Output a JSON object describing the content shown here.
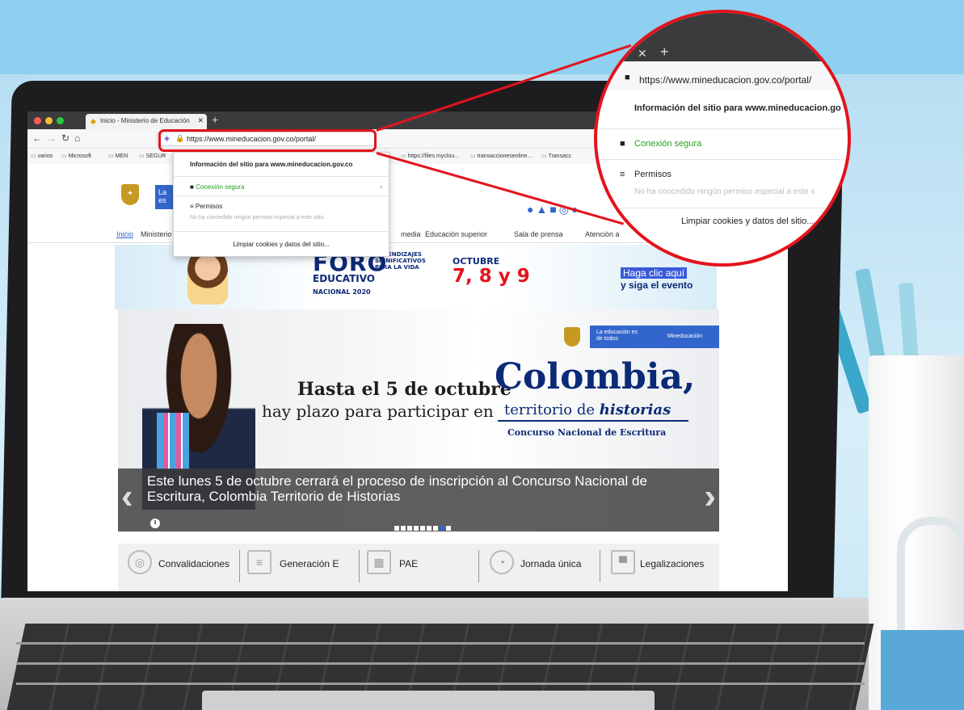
{
  "browser": {
    "tab_title": "Inicio - Ministerio de Educación",
    "tab_close": "✕",
    "new_tab": "+",
    "url": "https://www.mineducacion.gov.co/portal/",
    "bookmarks": [
      "varios",
      "Microsoft",
      "MEN",
      "SEGUR",
      "https://files.myclou...",
      "transaccionesenline...",
      "Transacc"
    ]
  },
  "site_info_popup": {
    "title": "Información del sitio para www.mineducacion.gov.co",
    "secure": "Conexión segura",
    "permissions": "Permisos",
    "permissions_detail": "No ha concedido ningún permiso especial a este sitio.",
    "clear": "Limpiar cookies y datos del sitio..."
  },
  "zoom": {
    "url": "https://www.mineducacion.gov.co/portal/",
    "title": "Información del sitio para www.mineducacion.go",
    "secure": "Conexión segura",
    "permissions": "Permisos",
    "permissions_detail": "No ha concedido ningún permiso especial a este s",
    "clear": "Limpiar cookies y datos del sitio..."
  },
  "site": {
    "logo_text": "La es",
    "menu": [
      "Inicio",
      "Ministerio",
      "media",
      "Educación superior",
      "Sala de prensa",
      "Atención a"
    ],
    "banner": {
      "foro": "FORO",
      "educativo": "EDUCATIVO",
      "nacional": "NACIONAL 2020",
      "small": "APRENDIZAJES SIGNIFICATIVOS PARA LA VIDA",
      "octubre": "OCTUBRE",
      "dates": "7, 8 y 9",
      "cta1": "Haga clic aquí",
      "cta2": "y siga el evento"
    },
    "hero": {
      "badge_text": "La educación es de todos",
      "badge_brand": "Mineducación",
      "line1": "Hasta el 5 de octubre",
      "line2": "hay plazo para participar en",
      "colombia": "Colombia,",
      "territorio": "territorio de",
      "historias": "historias",
      "concurso": "Concurso Nacional de Escritura",
      "caption": "Este lunes 5 de octubre cerrará el proceso de inscripción al Concurso Nacional de Escritura, Colombia Territorio de Historias",
      "slides": 9,
      "active_slide": 8
    },
    "quick_links": [
      "Convalidaciones",
      "Generación E",
      "PAE",
      "Jornada única",
      "Legalizaciones"
    ]
  }
}
